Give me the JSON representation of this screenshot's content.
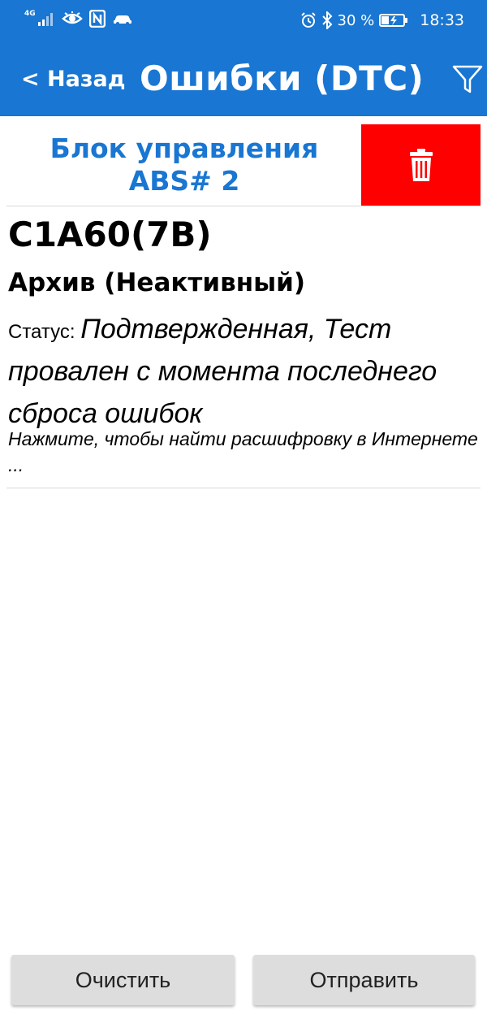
{
  "status_bar": {
    "network_label": "4G",
    "battery_percent": "30 %",
    "time": "18:33"
  },
  "toolbar": {
    "back_label": "< Назад",
    "title": "Ошибки (DTC)"
  },
  "ecu": {
    "title": "Блок управления ABS# 2"
  },
  "dtc": {
    "code": "C1A60(7B)",
    "archive": "Архив (Неактивный)",
    "status_label": "Статус: ",
    "status_value": "Подтвержденная, Тест провален с момента последнего сброса ошибок",
    "hint": "Нажмите, чтобы найти расшифровку в Интернете ..."
  },
  "buttons": {
    "clear_label": "Очистить",
    "send_label": "Отправить"
  },
  "colors": {
    "accent": "#1976d2",
    "delete": "#ff0000",
    "button_bg": "#dddddd"
  },
  "icons": {
    "filter": "filter-icon",
    "delete": "trash-icon",
    "signal": "signal-icon",
    "eye": "eye-icon",
    "nfc": "nfc-icon",
    "car": "car-icon",
    "alarm": "alarm-icon",
    "bluetooth": "bluetooth-icon",
    "battery": "battery-icon"
  }
}
